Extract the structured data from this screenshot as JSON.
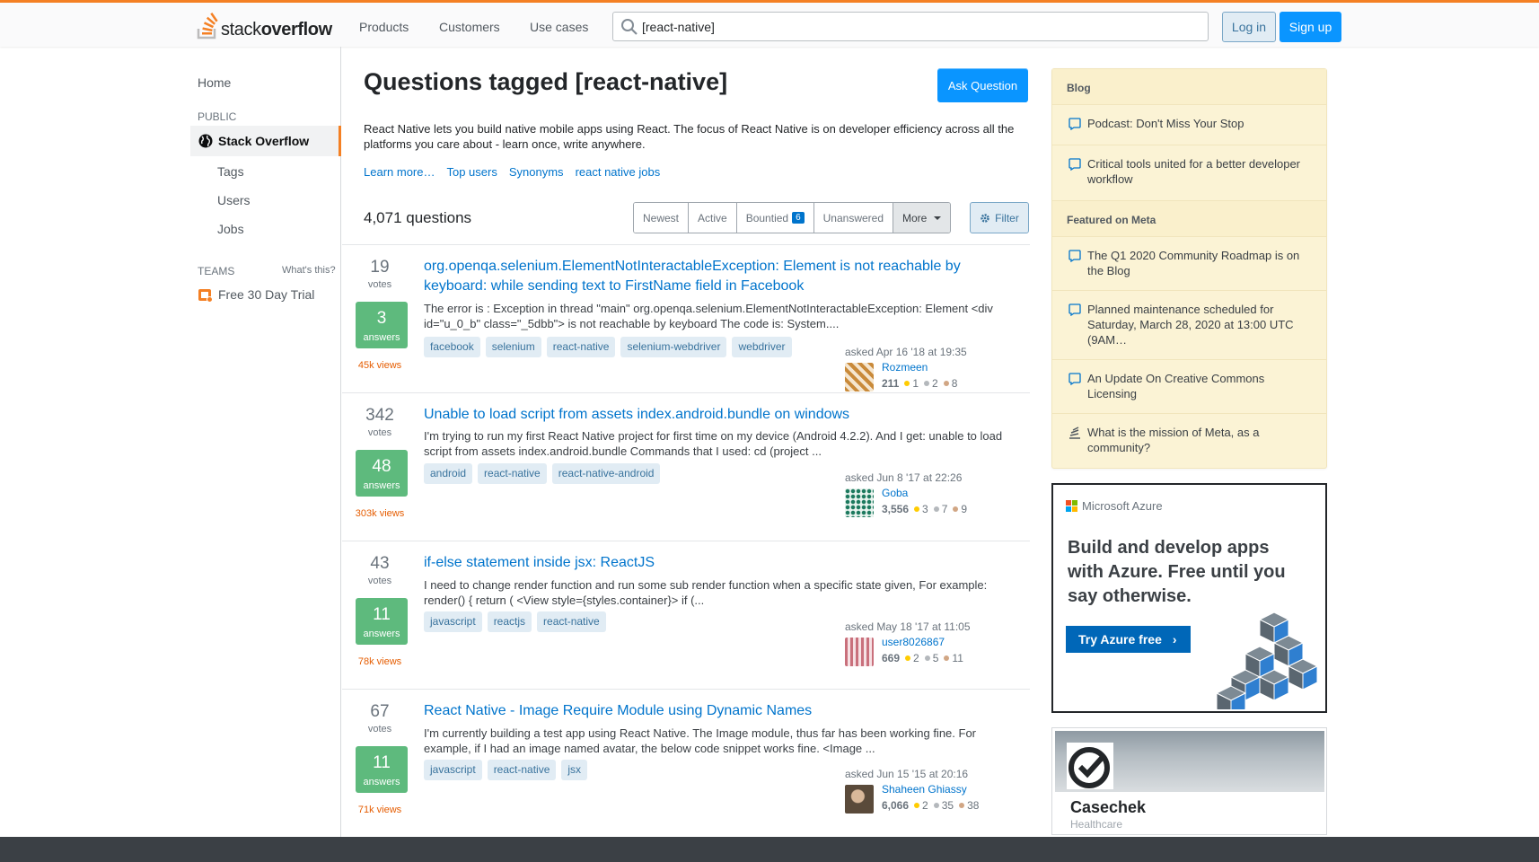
{
  "header": {
    "logo_text_light": "stack",
    "logo_text_bold": "overflow",
    "nav": [
      "Products",
      "Customers",
      "Use cases"
    ],
    "search_value": "[react-native]",
    "login_label": "Log in",
    "signup_label": "Sign up"
  },
  "sidebar": {
    "home": "Home",
    "public_label": "PUBLIC",
    "active_item": "Stack Overflow",
    "items": [
      "Tags",
      "Users",
      "Jobs"
    ],
    "teams_label": "TEAMS",
    "whats_this": "What's this?",
    "trial": "Free 30 Day Trial"
  },
  "main": {
    "title": "Questions tagged [react-native]",
    "ask_label": "Ask Question",
    "description": "React Native lets you build native mobile apps using React. The focus of React Native is on developer efficiency across all the platforms you care about - learn once, write anywhere.",
    "links": [
      "Learn more…",
      "Top users",
      "Synonyms",
      "react native jobs"
    ],
    "question_count": "4,071 questions",
    "filters": [
      "Newest",
      "Active",
      "Bountied",
      "Unanswered",
      "More"
    ],
    "bountied_count": "6",
    "filter_label": "Filter"
  },
  "questions": [
    {
      "votes": "19",
      "votes_label": "votes",
      "answers": "3",
      "answers_label": "answers",
      "views": "45k views",
      "title": "org.openqa.selenium.ElementNotInteractableException: Element is not reachable by keyboard: while sending text to FirstName field in Facebook",
      "excerpt": "The error is : Exception in thread \"main\" org.openqa.selenium.ElementNotInteractableException: Element <div id=\"u_0_b\" class=\"_5dbb\"> is not reachable by keyboard The code is: System....",
      "tags": [
        "facebook",
        "selenium",
        "react-native",
        "selenium-webdriver",
        "webdriver"
      ],
      "asked": "asked Apr 16 '18 at 19:35",
      "user": "Rozmeen",
      "rep": "211",
      "gold": "1",
      "silver": "2",
      "bronze": "8",
      "avatar_color": "#c98a3a"
    },
    {
      "votes": "342",
      "votes_label": "votes",
      "answers": "48",
      "answers_label": "answers",
      "views": "303k views",
      "title": "Unable to load script from assets index.android.bundle on windows",
      "excerpt": "I'm trying to run my first React Native project for first time on my device (Android 4.2.2). And I get: unable to load script from assets index.android.bundle Commands that I used: cd (project ...",
      "tags": [
        "android",
        "react-native",
        "react-native-android"
      ],
      "asked": "asked Jun 8 '17 at 22:26",
      "user": "Goba",
      "rep": "3,556",
      "gold": "3",
      "silver": "7",
      "bronze": "9",
      "avatar_color": "#1d7a5f"
    },
    {
      "votes": "43",
      "votes_label": "votes",
      "answers": "11",
      "answers_label": "answers",
      "views": "78k views",
      "title": "if-else statement inside jsx: ReactJS",
      "excerpt": "I need to change render function and run some sub render function when a specific state given, For example: render() { return ( <View style={styles.container}> if (...",
      "tags": [
        "javascript",
        "reactjs",
        "react-native"
      ],
      "asked": "asked May 18 '17 at 11:05",
      "user": "user8026867",
      "rep": "669",
      "gold": "2",
      "silver": "5",
      "bronze": "11",
      "avatar_color": "#c9707c"
    },
    {
      "votes": "67",
      "votes_label": "votes",
      "answers": "11",
      "answers_label": "answers",
      "views": "71k views",
      "title": "React Native - Image Require Module using Dynamic Names",
      "excerpt": "I'm currently building a test app using React Native. The Image module, thus far has been working fine. For example, if I had an image named avatar, the below code snippet works fine. <Image ...",
      "tags": [
        "javascript",
        "react-native",
        "jsx"
      ],
      "asked": "asked Jun 15 '15 at 20:16",
      "user": "Shaheen Ghiassy",
      "rep": "6,066",
      "gold": "2",
      "silver": "35",
      "bronze": "38",
      "avatar_color": "#5a4a3a"
    }
  ],
  "blog": {
    "blog_header": "Blog",
    "blog_items": [
      "Podcast: Don't Miss Your Stop",
      "Critical tools united for a better developer workflow"
    ],
    "meta_header": "Featured on Meta",
    "meta_items": [
      "The Q1 2020 Community Roadmap is on the Blog",
      "Planned maintenance scheduled for Saturday, March 28, 2020 at 13:00 UTC (9AM…",
      "An Update On Creative Commons Licensing",
      "What is the mission of Meta, as a community?"
    ]
  },
  "ads": {
    "azure_brand": "Microsoft Azure",
    "azure_headline": "Build and develop apps with Azure. Free until you say otherwise.",
    "azure_cta": "Try Azure free",
    "casechek_name": "Casechek",
    "casechek_sub": "Healthcare"
  },
  "colors": {
    "accent": "#f48024",
    "link": "#0074cc",
    "answered": "#5eba7d",
    "primary_button": "#0a95ff"
  }
}
